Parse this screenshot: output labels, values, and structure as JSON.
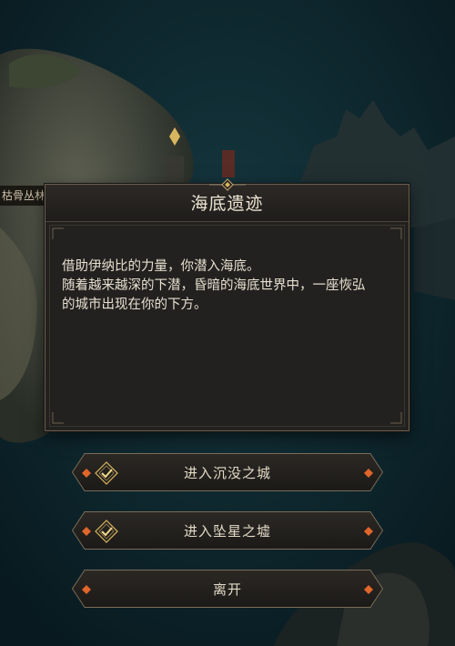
{
  "map": {
    "region_label": "枯骨丛林"
  },
  "dialog": {
    "title": "海底遗迹",
    "lines": [
      "借助伊纳比的力量，你潜入海底。",
      "随着越来越深的下潜，昏暗的海底世界中，一座恢弘",
      "的城市出现在你的下方。"
    ]
  },
  "options": [
    {
      "label": "进入沉没之城",
      "checked": true
    },
    {
      "label": "进入坠星之墟",
      "checked": true
    },
    {
      "label": "离开",
      "checked": false
    }
  ],
  "colors": {
    "accent_gold": "#d8b660",
    "gem_orange": "#e0662a",
    "frame": "#6b5f4e"
  }
}
